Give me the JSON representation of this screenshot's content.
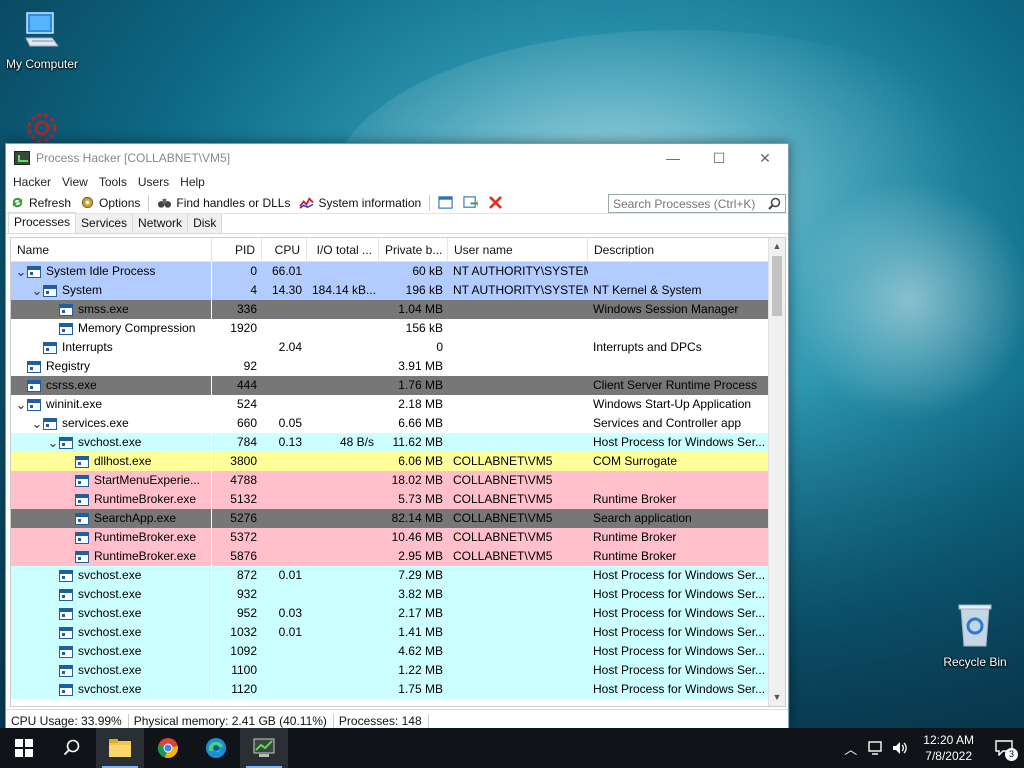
{
  "desktop": {
    "icons": [
      {
        "label": "My Computer"
      },
      {
        "label": "Recycle Bin"
      }
    ]
  },
  "window": {
    "title": "Process Hacker [COLLABNET\\VM5]",
    "controls": {
      "minimize": "—",
      "maximize": "☐",
      "close": "✕"
    },
    "menu": [
      "Hacker",
      "View",
      "Tools",
      "Users",
      "Help"
    ],
    "toolbar": {
      "refresh": "Refresh",
      "options": "Options",
      "find": "Find handles or DLLs",
      "sysinfo": "System information",
      "search_placeholder": "Search Processes (Ctrl+K)"
    },
    "tabs": [
      "Processes",
      "Services",
      "Network",
      "Disk"
    ],
    "columns": [
      "Name",
      "PID",
      "CPU",
      "I/O total ...",
      "Private b...",
      "User name",
      "Description"
    ],
    "rows": [
      {
        "indent": 0,
        "chev": "v",
        "name": "System Idle Process",
        "pid": "0",
        "cpu": "66.01",
        "io": "",
        "priv": "60 kB",
        "user": "NT AUTHORITY\\SYSTEM",
        "desc": "",
        "bg": "#b3ccff",
        "fg": "#000000"
      },
      {
        "indent": 1,
        "chev": "v",
        "name": "System",
        "pid": "4",
        "cpu": "14.30",
        "io": "184.14 kB...",
        "priv": "196 kB",
        "user": "NT AUTHORITY\\SYSTEM",
        "desc": "NT Kernel & System",
        "bg": "#b3ccff",
        "fg": "#000000"
      },
      {
        "indent": 2,
        "chev": "",
        "name": "smss.exe",
        "pid": "336",
        "cpu": "",
        "io": "",
        "priv": "1.04 MB",
        "user": "",
        "desc": "Windows Session Manager",
        "bg": "#777777",
        "fg": "#000000"
      },
      {
        "indent": 2,
        "chev": "",
        "name": "Memory Compression",
        "pid": "1920",
        "cpu": "",
        "io": "",
        "priv": "156 kB",
        "user": "",
        "desc": "",
        "bg": "#ffffff",
        "fg": "#000000"
      },
      {
        "indent": 1,
        "chev": "",
        "name": "Interrupts",
        "pid": "",
        "cpu": "2.04",
        "io": "",
        "priv": "0",
        "user": "",
        "desc": "Interrupts and DPCs",
        "bg": "#ffffff",
        "fg": "#000000"
      },
      {
        "indent": 0,
        "chev": "",
        "name": "Registry",
        "pid": "92",
        "cpu": "",
        "io": "",
        "priv": "3.91 MB",
        "user": "",
        "desc": "",
        "bg": "#ffffff",
        "fg": "#000000"
      },
      {
        "indent": 0,
        "chev": "",
        "name": "csrss.exe",
        "pid": "444",
        "cpu": "",
        "io": "",
        "priv": "1.76 MB",
        "user": "",
        "desc": "Client Server Runtime Process",
        "bg": "#777777",
        "fg": "#000000"
      },
      {
        "indent": 0,
        "chev": "v",
        "name": "wininit.exe",
        "pid": "524",
        "cpu": "",
        "io": "",
        "priv": "2.18 MB",
        "user": "",
        "desc": "Windows Start-Up Application",
        "bg": "#ffffff",
        "fg": "#000000"
      },
      {
        "indent": 1,
        "chev": "v",
        "name": "services.exe",
        "pid": "660",
        "cpu": "0.05",
        "io": "",
        "priv": "6.66 MB",
        "user": "",
        "desc": "Services and Controller app",
        "bg": "#ffffff",
        "fg": "#000000"
      },
      {
        "indent": 2,
        "chev": "v",
        "name": "svchost.exe",
        "pid": "784",
        "cpu": "0.13",
        "io": "48 B/s",
        "priv": "11.62 MB",
        "user": "",
        "desc": "Host Process for Windows Ser...",
        "bg": "#ccffff",
        "fg": "#000000"
      },
      {
        "indent": 3,
        "chev": "",
        "name": "dllhost.exe",
        "pid": "3800",
        "cpu": "",
        "io": "",
        "priv": "6.06 MB",
        "user": "COLLABNET\\VM5",
        "desc": "COM Surrogate",
        "bg": "#ffff99",
        "fg": "#000000"
      },
      {
        "indent": 3,
        "chev": "",
        "name": "StartMenuExperie...",
        "pid": "4788",
        "cpu": "",
        "io": "",
        "priv": "18.02 MB",
        "user": "COLLABNET\\VM5",
        "desc": "",
        "bg": "#ffc0cb",
        "fg": "#000000"
      },
      {
        "indent": 3,
        "chev": "",
        "name": "RuntimeBroker.exe",
        "pid": "5132",
        "cpu": "",
        "io": "",
        "priv": "5.73 MB",
        "user": "COLLABNET\\VM5",
        "desc": "Runtime Broker",
        "bg": "#ffc0cb",
        "fg": "#000000"
      },
      {
        "indent": 3,
        "chev": "",
        "name": "SearchApp.exe",
        "pid": "5276",
        "cpu": "",
        "io": "",
        "priv": "82.14 MB",
        "user": "COLLABNET\\VM5",
        "desc": "Search application",
        "bg": "#777777",
        "fg": "#000000"
      },
      {
        "indent": 3,
        "chev": "",
        "name": "RuntimeBroker.exe",
        "pid": "5372",
        "cpu": "",
        "io": "",
        "priv": "10.46 MB",
        "user": "COLLABNET\\VM5",
        "desc": "Runtime Broker",
        "bg": "#ffc0cb",
        "fg": "#000000"
      },
      {
        "indent": 3,
        "chev": "",
        "name": "RuntimeBroker.exe",
        "pid": "5876",
        "cpu": "",
        "io": "",
        "priv": "2.95 MB",
        "user": "COLLABNET\\VM5",
        "desc": "Runtime Broker",
        "bg": "#ffc0cb",
        "fg": "#000000"
      },
      {
        "indent": 2,
        "chev": "",
        "name": "svchost.exe",
        "pid": "872",
        "cpu": "0.01",
        "io": "",
        "priv": "7.29 MB",
        "user": "",
        "desc": "Host Process for Windows Ser...",
        "bg": "#ccffff",
        "fg": "#000000"
      },
      {
        "indent": 2,
        "chev": "",
        "name": "svchost.exe",
        "pid": "932",
        "cpu": "",
        "io": "",
        "priv": "3.82 MB",
        "user": "",
        "desc": "Host Process for Windows Ser...",
        "bg": "#ccffff",
        "fg": "#000000"
      },
      {
        "indent": 2,
        "chev": "",
        "name": "svchost.exe",
        "pid": "952",
        "cpu": "0.03",
        "io": "",
        "priv": "2.17 MB",
        "user": "",
        "desc": "Host Process for Windows Ser...",
        "bg": "#ccffff",
        "fg": "#000000"
      },
      {
        "indent": 2,
        "chev": "",
        "name": "svchost.exe",
        "pid": "1032",
        "cpu": "0.01",
        "io": "",
        "priv": "1.41 MB",
        "user": "",
        "desc": "Host Process for Windows Ser...",
        "bg": "#ccffff",
        "fg": "#000000"
      },
      {
        "indent": 2,
        "chev": "",
        "name": "svchost.exe",
        "pid": "1092",
        "cpu": "",
        "io": "",
        "priv": "4.62 MB",
        "user": "",
        "desc": "Host Process for Windows Ser...",
        "bg": "#ccffff",
        "fg": "#000000"
      },
      {
        "indent": 2,
        "chev": "",
        "name": "svchost.exe",
        "pid": "1100",
        "cpu": "",
        "io": "",
        "priv": "1.22 MB",
        "user": "",
        "desc": "Host Process for Windows Ser...",
        "bg": "#ccffff",
        "fg": "#000000"
      },
      {
        "indent": 2,
        "chev": "",
        "name": "svchost.exe",
        "pid": "1120",
        "cpu": "",
        "io": "",
        "priv": "1.75 MB",
        "user": "",
        "desc": "Host Process for Windows Ser...",
        "bg": "#ccffff",
        "fg": "#000000"
      }
    ],
    "status": {
      "cpu": "CPU Usage: 33.99%",
      "memory": "Physical memory: 2.41 GB (40.11%)",
      "processes": "Processes: 148"
    }
  },
  "taskbar": {
    "time": "12:20 AM",
    "date": "7/8/2022",
    "notifications": "3"
  },
  "colors": {
    "system": "#b3ccff",
    "service": "#ccffff",
    "user": "#ffc0cb",
    "suspended": "#777777",
    "dll": "#ffff99"
  }
}
